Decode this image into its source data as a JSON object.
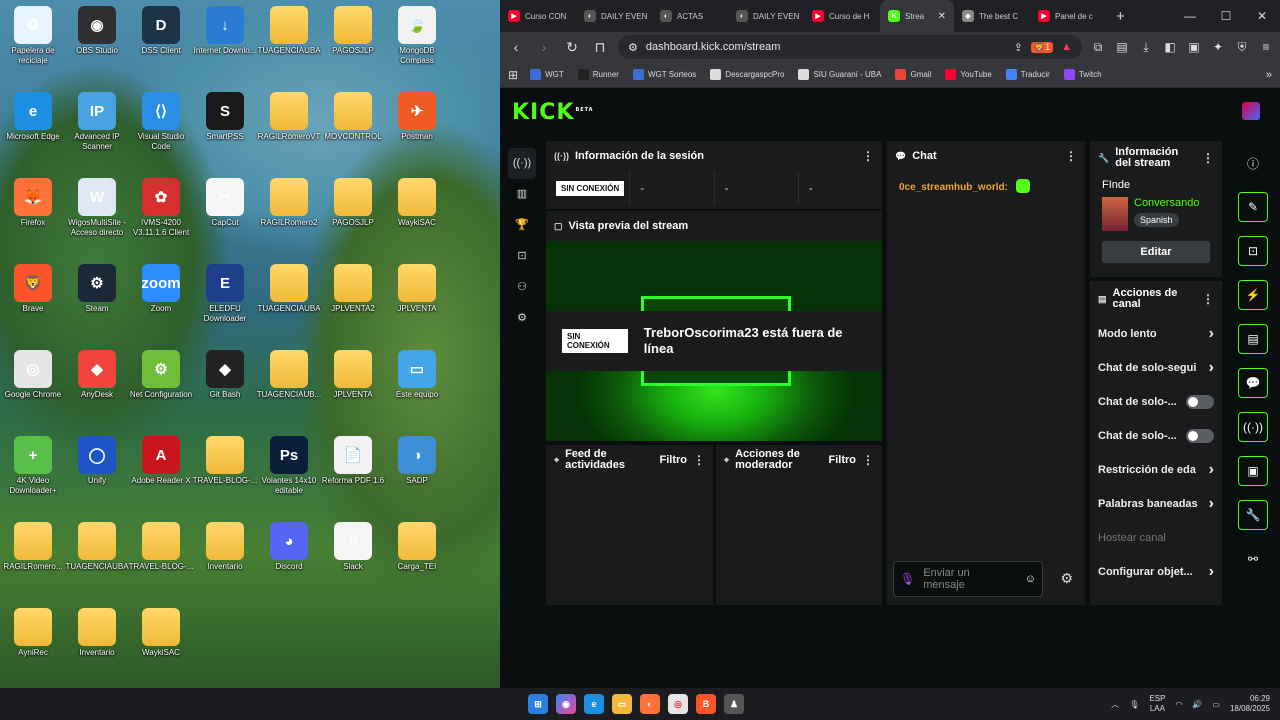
{
  "desktop": {
    "icons": [
      {
        "label": "Papelera de reciclaje",
        "icon": "recycle-bin-icon",
        "color": "#e8f4ff",
        "glyph": "♻"
      },
      {
        "label": "OBS Studio",
        "icon": "obs-icon",
        "color": "#302e31",
        "glyph": "◉"
      },
      {
        "label": "DSS Client",
        "icon": "dss-icon",
        "color": "#1d3446",
        "glyph": "D"
      },
      {
        "label": "Internet Downlo...",
        "icon": "idm-icon",
        "color": "#2a7bd6",
        "glyph": "↓"
      },
      {
        "label": "TUAGENCIAUBA",
        "icon": "folder-icon",
        "color": "folder",
        "glyph": ""
      },
      {
        "label": "PAGOSJLP",
        "icon": "folder-icon",
        "color": "folder",
        "glyph": ""
      },
      {
        "label": "MongoDB Compass",
        "icon": "mongodb-icon",
        "color": "#f2f2f2",
        "glyph": "🍃"
      },
      {
        "label": "Microsoft Edge",
        "icon": "edge-icon",
        "color": "#1d8fe0",
        "glyph": "e"
      },
      {
        "label": "Advanced IP Scanner",
        "icon": "ip-scanner-icon",
        "color": "#4aa3e0",
        "glyph": "IP"
      },
      {
        "label": "Visual Studio Code",
        "icon": "vscode-icon",
        "color": "#2b8ee6",
        "glyph": "⟨⟩"
      },
      {
        "label": "SmartPSS",
        "icon": "smartpss-icon",
        "color": "#1a1a1a",
        "glyph": "S"
      },
      {
        "label": "RAGILRomeroVT",
        "icon": "folder-icon",
        "color": "folder",
        "glyph": ""
      },
      {
        "label": "MOVCONTROL",
        "icon": "folder-icon",
        "color": "folder",
        "glyph": ""
      },
      {
        "label": "Postman",
        "icon": "postman-icon",
        "color": "#ef5b25",
        "glyph": "✈"
      },
      {
        "label": "Firefox",
        "icon": "firefox-icon",
        "color": "#ff7139",
        "glyph": "🦊"
      },
      {
        "label": "WigosMultiSite - Acceso directo",
        "icon": "wigos-icon",
        "color": "#dfe8f2",
        "glyph": "W"
      },
      {
        "label": "IVMS-4200 V3.11.1.6 Client",
        "icon": "ivms-icon",
        "color": "#d62f2f",
        "glyph": "✿"
      },
      {
        "label": "CapCut",
        "icon": "capcut-icon",
        "color": "#f5f5f5",
        "glyph": "✂"
      },
      {
        "label": "RAGILRomero2",
        "icon": "folder-icon",
        "color": "folder",
        "glyph": ""
      },
      {
        "label": "PAGOSJLP",
        "icon": "folder-icon",
        "color": "folder",
        "glyph": ""
      },
      {
        "label": "WaykiSAC",
        "icon": "folder-icon",
        "color": "folder",
        "glyph": ""
      },
      {
        "label": "Brave",
        "icon": "brave-icon",
        "color": "#fb542b",
        "glyph": "🦁"
      },
      {
        "label": "Steam",
        "icon": "steam-icon",
        "color": "#1b2838",
        "glyph": "⚙"
      },
      {
        "label": "Zoom",
        "icon": "zoom-icon",
        "color": "#2d8cff",
        "glyph": "zoom"
      },
      {
        "label": "ELEDFU Downloader",
        "icon": "eledfu-icon",
        "color": "#1e3f8a",
        "glyph": "E"
      },
      {
        "label": "TUAGENCIAUBA",
        "icon": "folder-icon",
        "color": "folder",
        "glyph": ""
      },
      {
        "label": "JPLVENTA2",
        "icon": "folder-icon",
        "color": "folder",
        "glyph": ""
      },
      {
        "label": "JPLVENTA",
        "icon": "folder-icon",
        "color": "folder",
        "glyph": ""
      },
      {
        "label": "Google Chrome",
        "icon": "chrome-icon",
        "color": "#e5e5e5",
        "glyph": "◎"
      },
      {
        "label": "AnyDesk",
        "icon": "anydesk-icon",
        "color": "#ef443b",
        "glyph": "◆"
      },
      {
        "label": "Net Configuration",
        "icon": "net-config-icon",
        "color": "#6fbf3a",
        "glyph": "⚙"
      },
      {
        "label": "Git Bash",
        "icon": "git-bash-icon",
        "color": "#222",
        "glyph": "◆"
      },
      {
        "label": "TUAGENCIAUB...",
        "icon": "folder-icon",
        "color": "folder",
        "glyph": ""
      },
      {
        "label": "JPLVENTA",
        "icon": "folder-icon",
        "color": "folder",
        "glyph": ""
      },
      {
        "label": "Este equipo",
        "icon": "this-pc-icon",
        "color": "#43a6e8",
        "glyph": "▭"
      },
      {
        "label": "4K Video Downloader+",
        "icon": "4k-downloader-icon",
        "color": "#58c04a",
        "glyph": "+"
      },
      {
        "label": "Unify",
        "icon": "unify-icon",
        "color": "#1f54c7",
        "glyph": "◯"
      },
      {
        "label": "Adobe Reader X",
        "icon": "adobe-reader-icon",
        "color": "#c9161c",
        "glyph": "A"
      },
      {
        "label": "TRAVEL-BLOG-...",
        "icon": "folder-icon",
        "color": "folder",
        "glyph": ""
      },
      {
        "label": "Volantes 14x10 editable",
        "icon": "photoshop-icon",
        "color": "#0a1e3a",
        "glyph": "Ps"
      },
      {
        "label": "Reforma PDF 1.6",
        "icon": "pdf-icon",
        "color": "#f2f2f2",
        "glyph": "📄"
      },
      {
        "label": "SADP",
        "icon": "sadp-icon",
        "color": "#3f8fd6",
        "glyph": "◑"
      },
      {
        "label": "RAGILRomero...",
        "icon": "folder-icon",
        "color": "folder",
        "glyph": ""
      },
      {
        "label": "TUAGENCIAUBA",
        "icon": "folder-icon",
        "color": "folder",
        "glyph": ""
      },
      {
        "label": "TRAVEL-BLOG-...",
        "icon": "folder-icon",
        "color": "folder",
        "glyph": ""
      },
      {
        "label": "Inventario",
        "icon": "folder-icon",
        "color": "folder",
        "glyph": ""
      },
      {
        "label": "Discord",
        "icon": "discord-icon",
        "color": "#5865f2",
        "glyph": "◕"
      },
      {
        "label": "Slack",
        "icon": "slack-icon",
        "color": "#f5f5f5",
        "glyph": "#"
      },
      {
        "label": "Carga_TEI",
        "icon": "folder-icon",
        "color": "folder",
        "glyph": ""
      },
      {
        "label": "AyniRec",
        "icon": "folder-icon",
        "color": "folder",
        "glyph": ""
      },
      {
        "label": "Inventario",
        "icon": "folder-icon",
        "color": "folder",
        "glyph": ""
      },
      {
        "label": "WaykiSAC",
        "icon": "folder-icon",
        "color": "folder",
        "glyph": ""
      }
    ]
  },
  "browser": {
    "tabs": [
      {
        "label": "Curso CON",
        "favicon": "youtube-icon",
        "color": "#ff0033",
        "glyph": "▶"
      },
      {
        "label": "DAILY EVEN",
        "favicon": "daily-icon",
        "color": "#555",
        "glyph": "◐"
      },
      {
        "label": "ACTAS",
        "favicon": "actas-icon",
        "color": "#555",
        "glyph": "◐"
      },
      {
        "label": "DAILY EVEN",
        "favicon": "daily-icon",
        "color": "#555",
        "glyph": "◐"
      },
      {
        "label": "Curso de H",
        "favicon": "youtube-icon",
        "color": "#ff0033",
        "glyph": "▶"
      },
      {
        "label": "Strea",
        "favicon": "kick-icon",
        "color": "#53fc18",
        "glyph": "K",
        "active": true
      },
      {
        "label": "The best C",
        "favicon": "diamond-icon",
        "color": "#888",
        "glyph": "◆"
      },
      {
        "label": "Panel de c",
        "favicon": "youtube-icon",
        "color": "#ff0033",
        "glyph": "▶"
      }
    ],
    "new_tab": "+",
    "window": {
      "minimize": "—",
      "maximize": "☐",
      "close": "✕"
    },
    "url": "dashboard.kick.com/stream",
    "brave_badge": "1",
    "bookmarks": [
      {
        "label": "WGT",
        "icon": "wgt-icon",
        "color": "#3a6fd6"
      },
      {
        "label": "Runner",
        "icon": "runner-icon",
        "color": "#222"
      },
      {
        "label": "WGT Sorteos",
        "icon": "wgt-sorteos-icon",
        "color": "#3a6fd6"
      },
      {
        "label": "DescargaspcPro",
        "icon": "descargas-icon",
        "color": "#ddd"
      },
      {
        "label": "SIU Guaraní - UBA",
        "icon": "siu-icon",
        "color": "#ddd"
      },
      {
        "label": "Gmail",
        "icon": "gmail-icon",
        "color": "#ea4335"
      },
      {
        "label": "YouTube",
        "icon": "youtube-icon",
        "color": "#ff0033"
      },
      {
        "label": "Traducir",
        "icon": "translate-icon",
        "color": "#4285f4"
      },
      {
        "label": "Twitch",
        "icon": "twitch-icon",
        "color": "#9146ff"
      }
    ]
  },
  "kick": {
    "logo": "KICK",
    "logo_tag": "BETA",
    "accent": "#53fc18",
    "session": {
      "title": "Información de la sesión",
      "status": "SIN CONEXIÓN",
      "stats": [
        "-",
        "-",
        "-"
      ]
    },
    "preview": {
      "title": "Vista previa del stream",
      "offline_badge": "SIN CONEXIÓN",
      "offline_text": "TreborOscorima23 está fuera de línea"
    },
    "activity": {
      "title": "Feed de actividades",
      "filter": "Filtro"
    },
    "moderator": {
      "title": "Acciones de moderador",
      "filter": "Filtro"
    },
    "chat": {
      "title": "Chat",
      "messages": [
        {
          "user": "0ce_streamhub_world:",
          "emote": "kick-emote-icon"
        }
      ],
      "placeholder": "Enviar un mensaje"
    },
    "stream_info": {
      "title": "Información del stream",
      "stream_title": "FInde",
      "category": "Conversando",
      "language": "Spanish",
      "edit": "Editar"
    },
    "channel_actions": {
      "title": "Acciones de canal",
      "items": [
        {
          "label": "Modo lento",
          "control": "chevron"
        },
        {
          "label": "Chat de solo-segui",
          "control": "chevron"
        },
        {
          "label": "Chat de solo-...",
          "control": "toggle"
        },
        {
          "label": "Chat de solo-...",
          "control": "toggle"
        },
        {
          "label": "Restricción de eda",
          "control": "chevron"
        },
        {
          "label": "Palabras baneadas",
          "control": "chevron"
        },
        {
          "label": "Hostear canal",
          "control": "none"
        },
        {
          "label": "Configurar objet...",
          "control": "chevron"
        }
      ]
    }
  },
  "taskbar": {
    "lang_top": "ESP",
    "lang_bottom": "LAA",
    "time": "06:29",
    "date": "18/08/2025"
  }
}
